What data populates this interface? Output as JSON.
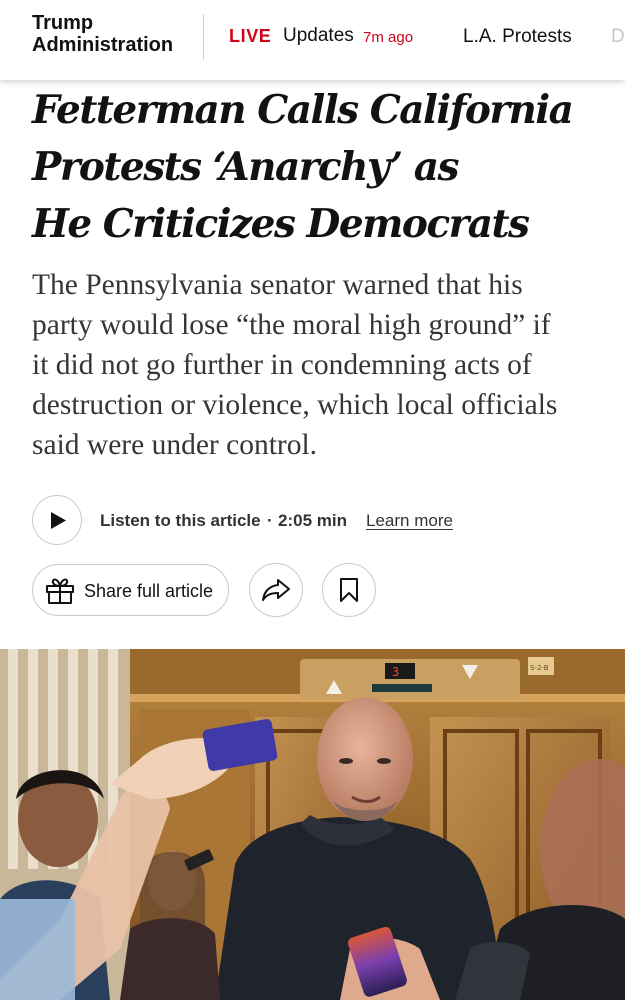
{
  "nav": {
    "section_title_line1": "Trump",
    "section_title_line2": "Administration",
    "live_label": "LIVE",
    "live_updates": "Updates",
    "live_time": "7m ago",
    "link_protests": "L.A. Protests",
    "link_next_partial": "D"
  },
  "article": {
    "headline_lines": [
      "Fetterman Calls California",
      "Protests ‘Anarchy’ as",
      "He Criticizes Democrats"
    ],
    "summary_lines": [
      "The Pennsylvania senator warned that his",
      "party would lose “the moral high ground” if",
      "it did not go further in condemning acts of",
      "destruction or violence, which local officials",
      "said were under control."
    ]
  },
  "audio": {
    "listen_label": "Listen to this article",
    "separator": "·",
    "duration": "2:05 min",
    "learn_more": "Learn more"
  },
  "share": {
    "share_full_label": "Share full article"
  },
  "photo": {
    "floor_indicator": "3",
    "elevator_sign": "S-2-B"
  },
  "colors": {
    "live_red": "#d0021b",
    "text": "#121212",
    "border": "#c9c9c9"
  },
  "icons": [
    "play-icon",
    "gift-icon",
    "share-arrow-icon",
    "bookmark-icon"
  ]
}
